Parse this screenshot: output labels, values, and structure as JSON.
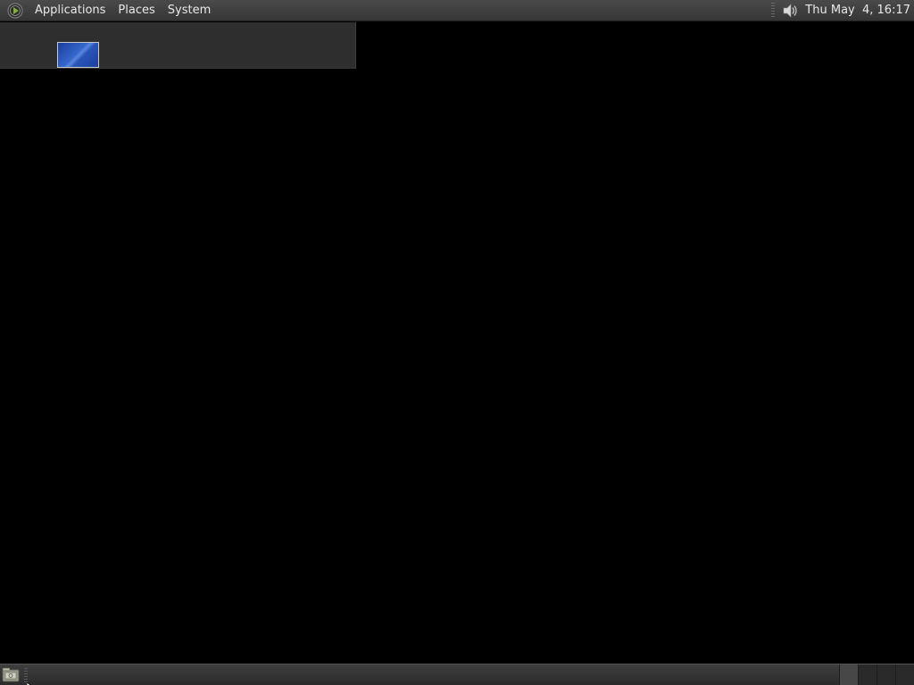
{
  "top_panel": {
    "menus": [
      {
        "label": "Applications",
        "icon": "distro-logo-icon"
      },
      {
        "label": "Places"
      },
      {
        "label": "System"
      }
    ],
    "tray": {
      "volume_icon": "speaker-volume-icon"
    },
    "clock": "Thu May  4, 16:17"
  },
  "workspace_popup": {
    "thumbnail_icon": "workspace-thumbnail"
  },
  "bottom_panel": {
    "show_desktop_icon": "show-desktop-icon",
    "workspaces": [
      {
        "active": true
      },
      {
        "active": false
      },
      {
        "active": false
      },
      {
        "active": false
      }
    ]
  },
  "colors": {
    "panel": "#3a3a3a",
    "desktop": "#000000",
    "accent_blue": "#2a55b8"
  }
}
